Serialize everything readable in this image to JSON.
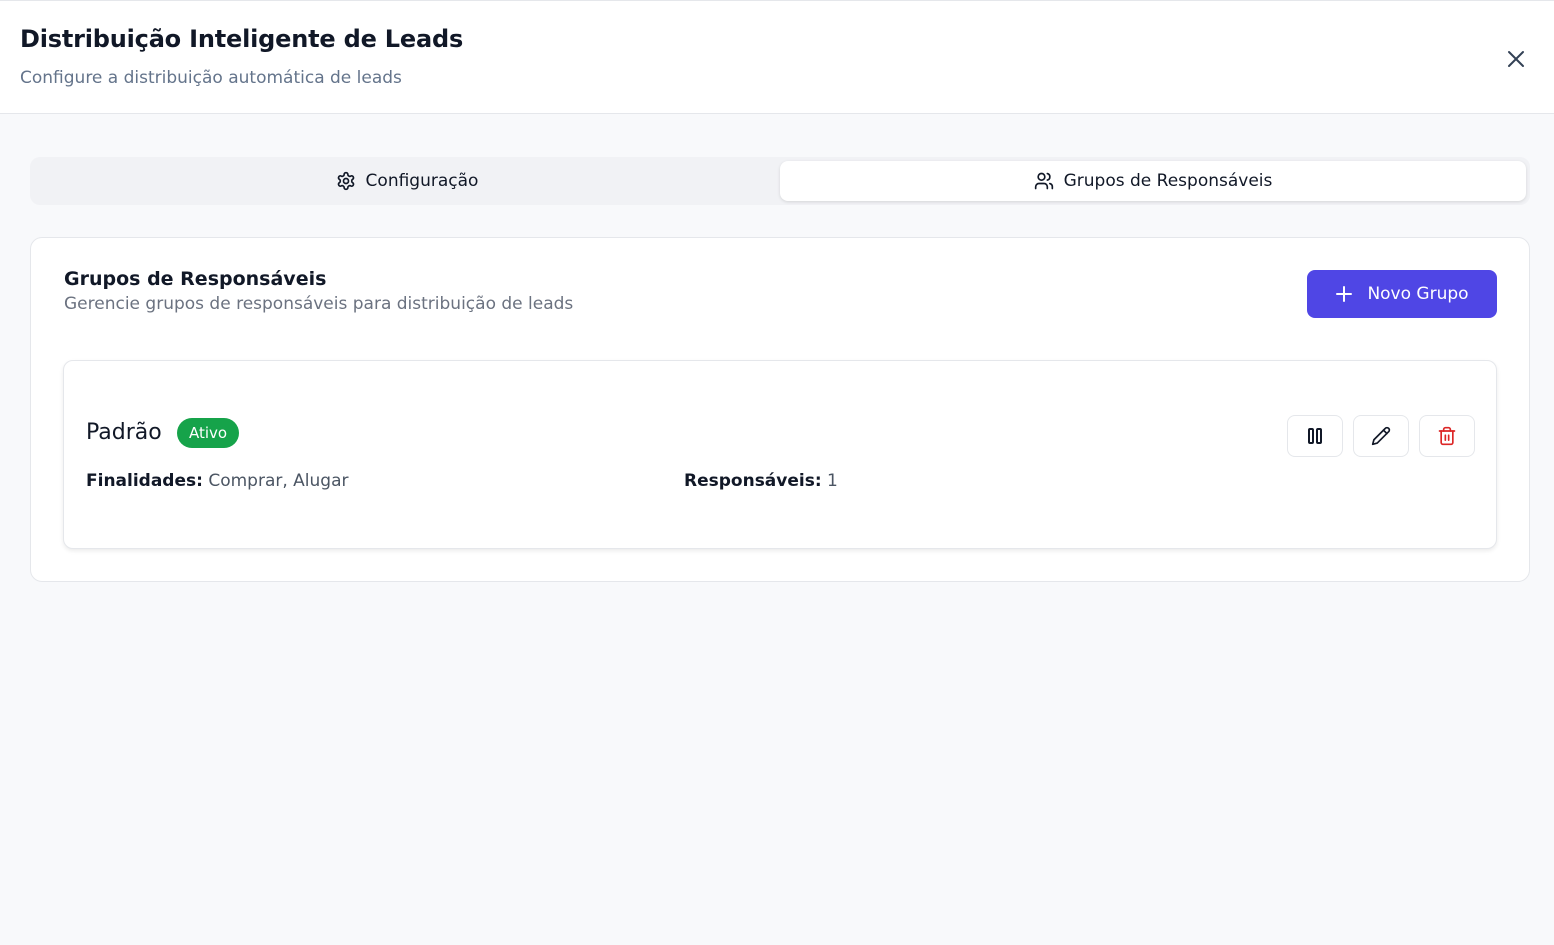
{
  "header": {
    "title": "Distribuição Inteligente de Leads",
    "subtitle": "Configure a distribuição automática de leads",
    "close_icon": "close-icon"
  },
  "tabs": [
    {
      "label": "Configuração",
      "icon": "gear-icon",
      "active": false
    },
    {
      "label": "Grupos de Responsáveis",
      "icon": "users-icon",
      "active": true
    }
  ],
  "section": {
    "title": "Grupos de Responsáveis",
    "subtitle": "Gerencie grupos de responsáveis para distribuição de leads",
    "new_button_label": "Novo Grupo",
    "new_button_icon": "plus-icon"
  },
  "groups": [
    {
      "name": "Padrão",
      "status": "Ativo",
      "finalidades_label": "Finalidades:",
      "finalidades_value": "Comprar, Alugar",
      "responsaveis_label": "Responsáveis:",
      "responsaveis_value": "1",
      "actions": [
        "pause-icon",
        "pencil-icon",
        "trash-icon"
      ]
    }
  ],
  "colors": {
    "accent": "#4f46e5",
    "status_active": "#16a34a",
    "danger": "#dc2626"
  }
}
